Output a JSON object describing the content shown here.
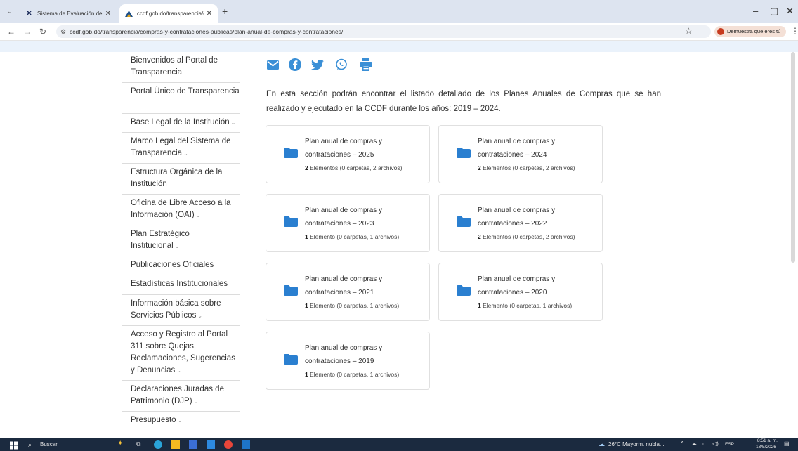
{
  "browser": {
    "tabs": [
      {
        "title": "Sistema de Evaluación de Porta",
        "active": false
      },
      {
        "title": "ccdf.gob.do/transparencia/con",
        "active": true
      }
    ],
    "new_tab": "+",
    "url": "ccdf.gob.do/transparencia/compras-y-contrataciones-publicas/plan-anual-de-compras-y-contrataciones/",
    "profile_label": "Demuestra que eres tú"
  },
  "sidebar": {
    "items": [
      {
        "label": "Bienvenidos al Portal de Transparencia",
        "chevron": false
      },
      {
        "label": "Portal Único de Transparencia",
        "chevron": false
      },
      {
        "label": "Base Legal de la Institución",
        "chevron": true
      },
      {
        "label": "Marco Legal del Sistema de Transparencia",
        "chevron": true
      },
      {
        "label": "Estructura Orgánica de la Institución",
        "chevron": false
      },
      {
        "label": "Oficina de Libre Acceso a la Información (OAI)",
        "chevron": true
      },
      {
        "label": "Plan Estratégico Institucional",
        "chevron": true
      },
      {
        "label": "Publicaciones Oficiales",
        "chevron": false
      },
      {
        "label": "Estadísticas Institucionales",
        "chevron": false
      },
      {
        "label": "Información básica sobre Servicios Públicos",
        "chevron": true
      },
      {
        "label": "Acceso y Registro al Portal 311 sobre Quejas, Reclamaciones, Sugerencias y Denuncias",
        "chevron": true
      },
      {
        "label": "Declaraciones Juradas de Patrimonio (DJP)",
        "chevron": true
      },
      {
        "label": "Presupuesto",
        "chevron": true
      }
    ]
  },
  "share_icons": [
    "email-icon",
    "facebook-icon",
    "twitter-icon",
    "whatsapp-icon",
    "print-icon"
  ],
  "intro": "En esta sección podrán encontrar el listado detallado de los Planes Anuales de Compras que se han realizado y ejecutado en la CCDF durante los años: 2019 – 2024.",
  "folders": [
    {
      "title": "Plan anual de compras y contrataciones – 2025",
      "count": "2",
      "meta": " Elementos (0 carpetas, 2 archivos)"
    },
    {
      "title": "Plan anual de compras y contrataciones – 2024",
      "count": "2",
      "meta": " Elementos (0 carpetas, 2 archivos)"
    },
    {
      "title": "Plan anual de compras y contrataciones – 2023",
      "count": "1",
      "meta": " Elemento (0 carpetas, 1 archivos)"
    },
    {
      "title": "Plan anual de compras y contrataciones – 2022",
      "count": "2",
      "meta": " Elementos (0 carpetas, 2 archivos)"
    },
    {
      "title": "Plan anual de compras y contrataciones – 2021",
      "count": "1",
      "meta": " Elemento (0 carpetas, 1 archivos)"
    },
    {
      "title": "Plan anual de compras y contrataciones – 2020",
      "count": "1",
      "meta": " Elemento (0 carpetas, 1 archivos)"
    },
    {
      "title": "Plan anual de compras y contrataciones – 2019",
      "count": "1",
      "meta": " Elemento (0 carpetas, 1 archivos)"
    }
  ],
  "taskbar": {
    "search_label": "Buscar",
    "weather": "26°C Mayorm. nubla...",
    "language": "ESP",
    "time": "8:51 a. m.",
    "date": "13/5/2026"
  },
  "colors": {
    "share_blue": "#3a8fd6",
    "folder_blue": "#2a7fd0",
    "taskbar_bg": "#1b2a3f"
  }
}
